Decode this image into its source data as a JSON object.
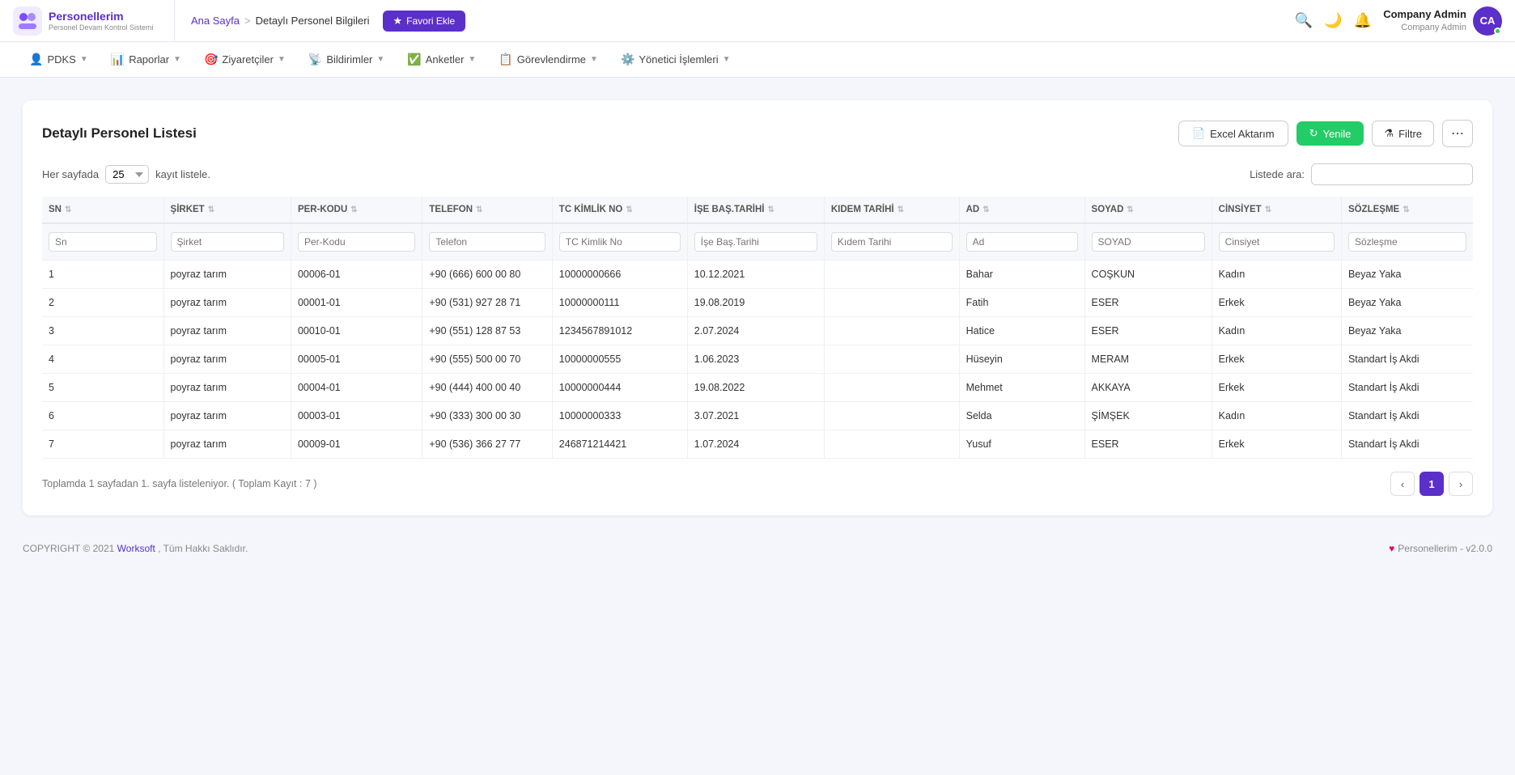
{
  "brand": {
    "title": "Personellerim",
    "subtitle": "Personel Devam Kontrol Sistemi",
    "avatar_initials": "CA"
  },
  "breadcrumb": {
    "home": "Ana Sayfa",
    "separator": ">",
    "current": "Detaylı Personel Bilgileri",
    "fav_label": "Favori Ekle"
  },
  "user": {
    "name": "Company Admin",
    "role": "Company Admin"
  },
  "mainnav": [
    {
      "id": "pdks",
      "icon": "👤",
      "label": "PDKS"
    },
    {
      "id": "raporlar",
      "icon": "📊",
      "label": "Raporlar"
    },
    {
      "id": "ziyaretciler",
      "icon": "🎯",
      "label": "Ziyaretçiler"
    },
    {
      "id": "bildirimler",
      "icon": "📡",
      "label": "Bildirimler"
    },
    {
      "id": "anketler",
      "icon": "✅",
      "label": "Anketler"
    },
    {
      "id": "gorevlendirme",
      "icon": "📋",
      "label": "Görevlendirme"
    },
    {
      "id": "yonetici",
      "icon": "⚙️",
      "label": "Yönetici İşlemleri"
    }
  ],
  "page": {
    "title": "Detaylı Personel Listesi",
    "excel_btn": "Excel Aktarım",
    "refresh_btn": "Yenile",
    "filter_btn": "Filtre",
    "more_btn": "⋯",
    "per_page_label": "Her sayfada",
    "per_page_value": "25",
    "per_page_suffix": "kayıt listele.",
    "search_label": "Listede ara:",
    "search_placeholder": ""
  },
  "columns": [
    {
      "id": "sn",
      "label": "SN",
      "filter_placeholder": "Sn"
    },
    {
      "id": "sirket",
      "label": "ŞİRKET",
      "filter_placeholder": "Şirket"
    },
    {
      "id": "per_kodu",
      "label": "PER-KODU",
      "filter_placeholder": "Per-Kodu"
    },
    {
      "id": "telefon",
      "label": "TELEFON",
      "filter_placeholder": "Telefon"
    },
    {
      "id": "tc_kimlik",
      "label": "TC KİMLİK NO",
      "filter_placeholder": "TC Kimlik No"
    },
    {
      "id": "ise_bas",
      "label": "İŞE BAŞ.TARİHİ",
      "filter_placeholder": "İşe Baş.Tarihi"
    },
    {
      "id": "kidem",
      "label": "KIDEM TARİHİ",
      "filter_placeholder": "Kıdem Tarihi"
    },
    {
      "id": "ad",
      "label": "AD",
      "filter_placeholder": "Ad"
    },
    {
      "id": "soyad",
      "label": "SOYAD",
      "filter_placeholder": "SOYAD"
    },
    {
      "id": "cinsiyet",
      "label": "CİNSİYET",
      "filter_placeholder": "Cinsiyet"
    },
    {
      "id": "sozlesme",
      "label": "SÖZLEŞME",
      "filter_placeholder": "Sözleşme"
    }
  ],
  "rows": [
    {
      "sn": "1",
      "sirket": "poyraz tarım",
      "per_kodu": "00006-01",
      "telefon": "+90 (666) 600 00 80",
      "tc_kimlik": "10000000666",
      "ise_bas": "10.12.2021",
      "kidem": "",
      "ad": "Bahar",
      "soyad": "COŞKUN",
      "cinsiyet": "Kadın",
      "sozlesme": "Beyaz Yaka"
    },
    {
      "sn": "2",
      "sirket": "poyraz tarım",
      "per_kodu": "00001-01",
      "telefon": "+90 (531) 927 28 71",
      "tc_kimlik": "10000000111",
      "ise_bas": "19.08.2019",
      "kidem": "",
      "ad": "Fatih",
      "soyad": "ESER",
      "cinsiyet": "Erkek",
      "sozlesme": "Beyaz Yaka"
    },
    {
      "sn": "3",
      "sirket": "poyraz tarım",
      "per_kodu": "00010-01",
      "telefon": "+90 (551) 128 87 53",
      "tc_kimlik": "1234567891012",
      "ise_bas": "2.07.2024",
      "kidem": "",
      "ad": "Hatice",
      "soyad": "ESER",
      "cinsiyet": "Kadın",
      "sozlesme": "Beyaz Yaka"
    },
    {
      "sn": "4",
      "sirket": "poyraz tarım",
      "per_kodu": "00005-01",
      "telefon": "+90 (555) 500 00 70",
      "tc_kimlik": "10000000555",
      "ise_bas": "1.06.2023",
      "kidem": "",
      "ad": "Hüseyin",
      "soyad": "MERAM",
      "cinsiyet": "Erkek",
      "sozlesme": "Standart İş Akdi"
    },
    {
      "sn": "5",
      "sirket": "poyraz tarım",
      "per_kodu": "00004-01",
      "telefon": "+90 (444) 400 00 40",
      "tc_kimlik": "10000000444",
      "ise_bas": "19.08.2022",
      "kidem": "",
      "ad": "Mehmet",
      "soyad": "AKKAYA",
      "cinsiyet": "Erkek",
      "sozlesme": "Standart İş Akdi"
    },
    {
      "sn": "6",
      "sirket": "poyraz tarım",
      "per_kodu": "00003-01",
      "telefon": "+90 (333) 300 00 30",
      "tc_kimlik": "10000000333",
      "ise_bas": "3.07.2021",
      "kidem": "",
      "ad": "Selda",
      "soyad": "ŞİMŞEK",
      "cinsiyet": "Kadın",
      "sozlesme": "Standart İş Akdi"
    },
    {
      "sn": "7",
      "sirket": "poyraz tarım",
      "per_kodu": "00009-01",
      "telefon": "+90 (536) 366 27 77",
      "tc_kimlik": "246871214421",
      "ise_bas": "1.07.2024",
      "kidem": "",
      "ad": "Yusuf",
      "soyad": "ESER",
      "cinsiyet": "Erkek",
      "sozlesme": "Standart İş Akdi"
    }
  ],
  "pagination": {
    "info": "Toplamda 1 sayfadan 1. sayfa listeleniyor. ( Toplam Kayıt : 7 )",
    "prev": "‹",
    "next": "›",
    "current_page": "1"
  },
  "footer": {
    "copyright": "COPYRIGHT © 2021",
    "company": "Worksoft",
    "rights": ", Tüm Hakkı Saklıdır.",
    "version": "Personellerim - v2.0.0"
  }
}
